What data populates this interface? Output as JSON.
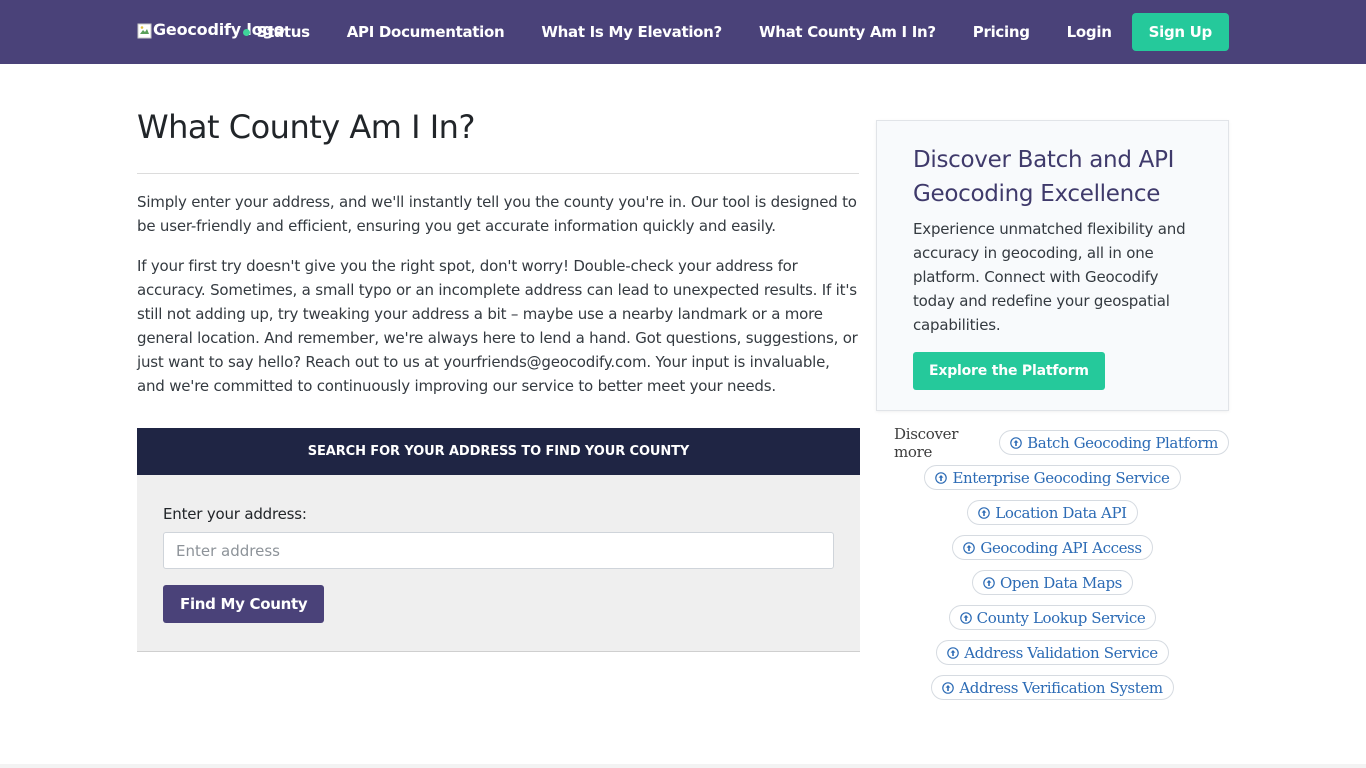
{
  "nav": {
    "logo_alt": "Geocodify logo",
    "links": [
      {
        "label": "Status"
      },
      {
        "label": "API Documentation"
      },
      {
        "label": "What Is My Elevation?"
      },
      {
        "label": "What County Am I In?"
      },
      {
        "label": "Pricing"
      },
      {
        "label": "Login"
      }
    ],
    "signup_label": "Sign Up",
    "status_color": "#3fd59a"
  },
  "main": {
    "title": "What County Am I In?",
    "paragraphs": [
      "Simply enter your address, and we'll instantly tell you the county you're in. Our tool is designed to be user-friendly and efficient, ensuring you get accurate information quickly and easily.",
      "If your first try doesn't give you the right spot, don't worry! Double-check your address for accuracy. Sometimes, a small typo or an incomplete address can lead to unexpected results. If it's still not adding up, try tweaking your address a bit – maybe use a nearby landmark or a more general location. And remember, we're always here to lend a hand. Got questions, suggestions, or just want to say hello? Reach out to us at yourfriends@geocodify.com. Your input is invaluable, and we're committed to continuously improving our service to better meet your needs."
    ]
  },
  "search": {
    "header": "SEARCH FOR YOUR ADDRESS TO FIND YOUR COUNTY",
    "label": "Enter your address:",
    "placeholder": "Enter address",
    "value": "",
    "button": "Find My County"
  },
  "promo": {
    "title": "Discover Batch and API Geocoding Excellence",
    "text": "Experience unmatched flexibility and accuracy in geocoding, all in one platform. Connect with Geocodify today and redefine your geospatial capabilities.",
    "button": "Explore the Platform"
  },
  "discover": {
    "label": "Discover more",
    "links": [
      "Batch Geocoding Platform",
      "Enterprise Geocoding Service",
      "Location Data API",
      "Geocoding API Access",
      "Open Data Maps",
      "County Lookup Service",
      "Address Validation Service",
      "Address Verification System"
    ]
  },
  "colors": {
    "nav_bg": "#4a4279",
    "accent": "#25c99b",
    "search_header_bg": "#1f2544",
    "link": "#2c6bb5"
  }
}
